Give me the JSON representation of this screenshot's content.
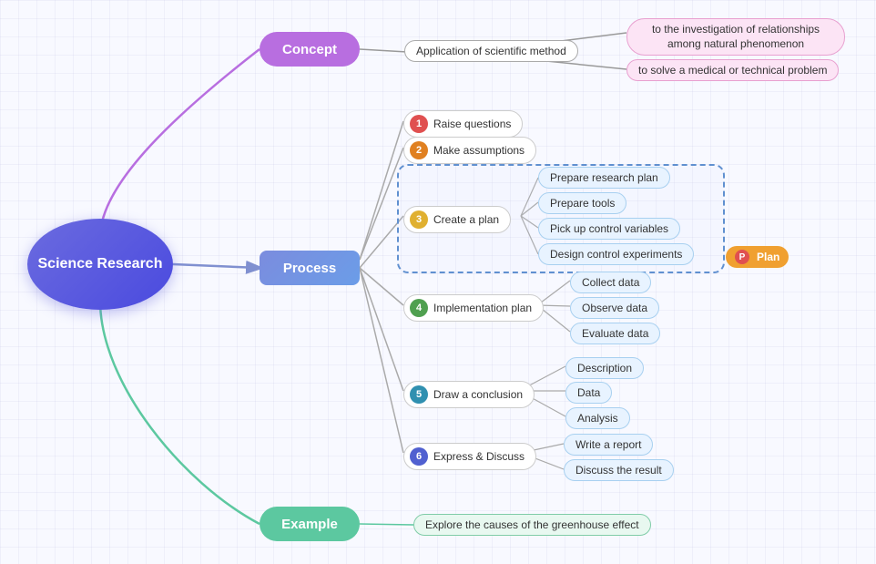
{
  "center": {
    "label": "Science Research"
  },
  "concept": {
    "label": "Concept"
  },
  "process": {
    "label": "Process"
  },
  "example": {
    "label": "Example"
  },
  "concept_children": {
    "app_scientific": "Application of scientific method",
    "child1": "to the investigation of relationships among natural phenomenon",
    "child2": "to solve a medical or technical problem"
  },
  "steps": {
    "s1": {
      "num": "1",
      "label": "Raise questions",
      "color": "badge-red"
    },
    "s2": {
      "num": "2",
      "label": "Make assumptions",
      "color": "badge-orange"
    },
    "s3": {
      "num": "3",
      "label": "Create a plan",
      "color": "badge-yellow"
    },
    "s4": {
      "num": "4",
      "label": "Implementation plan",
      "color": "badge-green"
    },
    "s5": {
      "num": "5",
      "label": "Draw a conclusion",
      "color": "badge-teal"
    },
    "s6": {
      "num": "6",
      "label": "Express & Discuss",
      "color": "badge-blue"
    }
  },
  "create_plan_children": [
    "Prepare research plan",
    "Prepare tools",
    "Pick up control variables",
    "Design control experiments"
  ],
  "impl_plan_children": [
    "Collect data",
    "Observe data",
    "Evaluate data"
  ],
  "draw_conclusion_children": [
    "Description",
    "Data",
    "Analysis"
  ],
  "express_discuss_children": [
    "Write a report",
    "Discuss the result"
  ],
  "example_child": "Explore the causes of the greenhouse effect",
  "plan_badge": "Plan"
}
